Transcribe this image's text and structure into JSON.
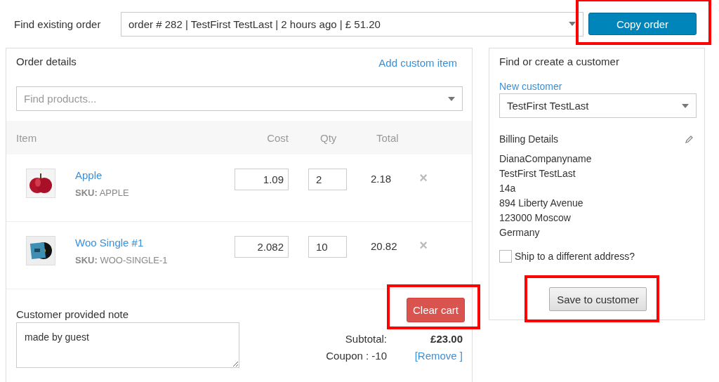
{
  "find_order": {
    "label": "Find existing order",
    "value": "order # 282 | TestFirst TestLast | 2 hours ago | £ 51.20"
  },
  "copy_button": {
    "label": "Copy order",
    "highlighted": true
  },
  "order_details": {
    "title": "Order details",
    "add_custom_item": "Add custom item",
    "find_products": {
      "placeholder": "Find products..."
    },
    "columns": [
      "Item",
      "Cost",
      "Qty",
      "Total"
    ],
    "rows": [
      {
        "name": "Apple",
        "sku_label": "SKU:",
        "sku": "APPLE",
        "cost": "1.09",
        "qty": "2",
        "total": "2.18",
        "remove": "×"
      },
      {
        "name": "Woo Single #1",
        "sku_label": "SKU:",
        "sku": "WOO-SINGLE-1",
        "cost": "2.082",
        "qty": "10",
        "total": "20.82",
        "remove": "×"
      }
    ],
    "note": {
      "label": "Customer provided note",
      "value": "made by guest"
    },
    "clear_button": {
      "label": "Clear cart",
      "highlighted": true
    },
    "totals": [
      {
        "label": "Subtotal:",
        "value": "£23.00",
        "kind": "amount"
      },
      {
        "label": "Coupon : -10",
        "value": "[Remove ]",
        "kind": "link"
      }
    ]
  },
  "customer": {
    "title": "Find or create a customer",
    "new_customer": "New customer",
    "selected_customer": "TestFirst TestLast",
    "billing_title": "Billing Details",
    "address": [
      "DianaCompanyname",
      "TestFirst TestLast",
      "14a",
      "894 Liberty Avenue",
      "123000 Moscow",
      "Germany"
    ],
    "ship_different": {
      "label": "Ship to a different address?",
      "checked": false
    },
    "save_button": {
      "label": "Save to customer",
      "highlighted": true
    }
  }
}
